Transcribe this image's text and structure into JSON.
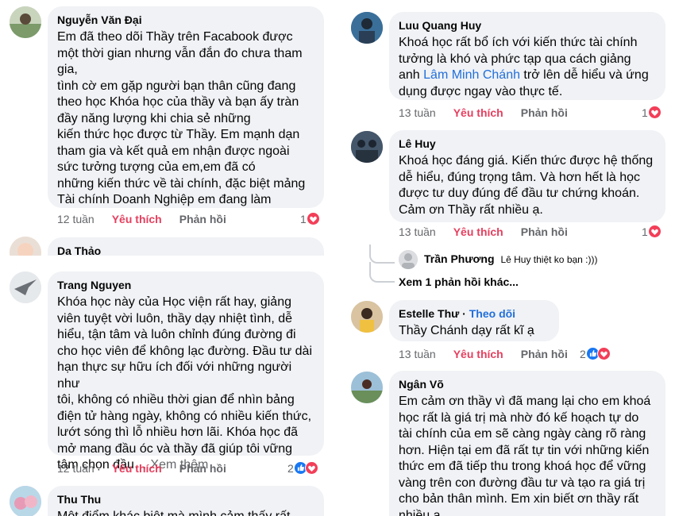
{
  "left_comments": [
    {
      "author": "Nguyễn Văn Đại",
      "text": "Em đã theo dõi Thầy trên Facabook được\nmột thời gian nhưng vẫn đắn đo chưa tham\ngia,\ntình cờ em gặp người bạn thân cũng đang\ntheo học Khóa học của thầy và bạn ấy tràn\nđầy năng lượng khi chia sẻ những\nkiến thức học được từ Thầy. Em mạnh dạn\ntham gia và kết quả em nhận được ngoài\nsức tưởng tượng của em,em đã có\nnhững kiến thức về tài chính, đặc biệt mảng\nTài chính Doanh Nghiệp em đang làm",
      "time": "12 tuần",
      "like": "Yêu thích",
      "reply": "Phản hồi",
      "count": "1"
    },
    {
      "author": "Da Thảo"
    },
    {
      "author": "Trang Nguyen",
      "text": "Khóa học này của Học viện rất hay, giảng\nviên tuyệt vời luôn, thầy dạy nhiệt tình, dễ\nhiểu, tận tâm và luôn chỉnh đúng đường đi\ncho học viên để không lạc đường. Đầu tư dài\nhạn thực sự hữu ích đối với những người như\ntôi, không có nhiều thời gian để nhìn bảng\nđiện tử hàng ngày, không có nhiều kiến thức,\nlướt sóng thì lỗ nhiều hơn lãi. Khóa học đã\nmở mang đầu óc và thầy đã giúp tôi vững\ntâm chọn đầu…",
      "see_more": "Xem thêm",
      "time": "12 tuần",
      "like": "Yêu thích",
      "reply": "Phản hồi",
      "count": "2"
    },
    {
      "author": "Thu Thu",
      "text": "Một điểm khác biệt mà mình cảm thấy rất"
    }
  ],
  "right_comments": [
    {
      "author": "Luu Quang Huy",
      "text_before": "Khoá học rất bổ ích với kiến thức tài chính\ntưởng là khó và phức tạp qua cách giảng\nanh ",
      "mention": "Lâm Minh Chánh",
      "text_after": " trở lên dễ hiểu và ứng\ndụng được ngay vào thực tế.",
      "time": "13 tuần",
      "like": "Yêu thích",
      "reply": "Phản hồi",
      "count": "1"
    },
    {
      "author": "Lê Huy",
      "text": "Khoá học đáng giá. Kiến thức được hệ thống\ndễ hiểu, đúng trọng tâm. Và hơn hết là học\nđược tư duy đúng để đầu tư chứng khoán.\nCảm ơn Thầy rất nhiều ạ.",
      "time": "13 tuần",
      "like": "Yêu thích",
      "reply": "Phản hồi",
      "count": "1",
      "reply_author": "Trần Phương",
      "reply_text": "Lê Huy thiệt ko bạn :)))",
      "more_replies": "Xem 1 phản hồi khác..."
    },
    {
      "author": "Estelle Thư",
      "follow": "Theo dõi",
      "text": "Thầy Chánh dạy rất kĩ ạ",
      "time": "13 tuần",
      "like": "Yêu thích",
      "reply": "Phản hồi",
      "count": "2"
    },
    {
      "author": "Ngân Võ",
      "text": "Em cảm ơn thầy vì đã mang lại cho em khoá\nhọc rất là giá trị mà nhờ đó kế hoạch tự do\ntài chính của em sẽ càng ngày càng rõ ràng\nhơn. Hiện tại em đã rất tự tin với những kiến\nthức em đã tiếp thu trong khoá học để vững\nvàng trên con đường đầu tư và tạo ra giá trị\ncho bản thân mình. Em xin biết ơn thầy rất\nnhiều ạ."
    }
  ],
  "colors": {
    "like": "#e4405f",
    "bubble": "#f0f2f5",
    "meta": "#65676b",
    "mention": "#216fdb"
  }
}
